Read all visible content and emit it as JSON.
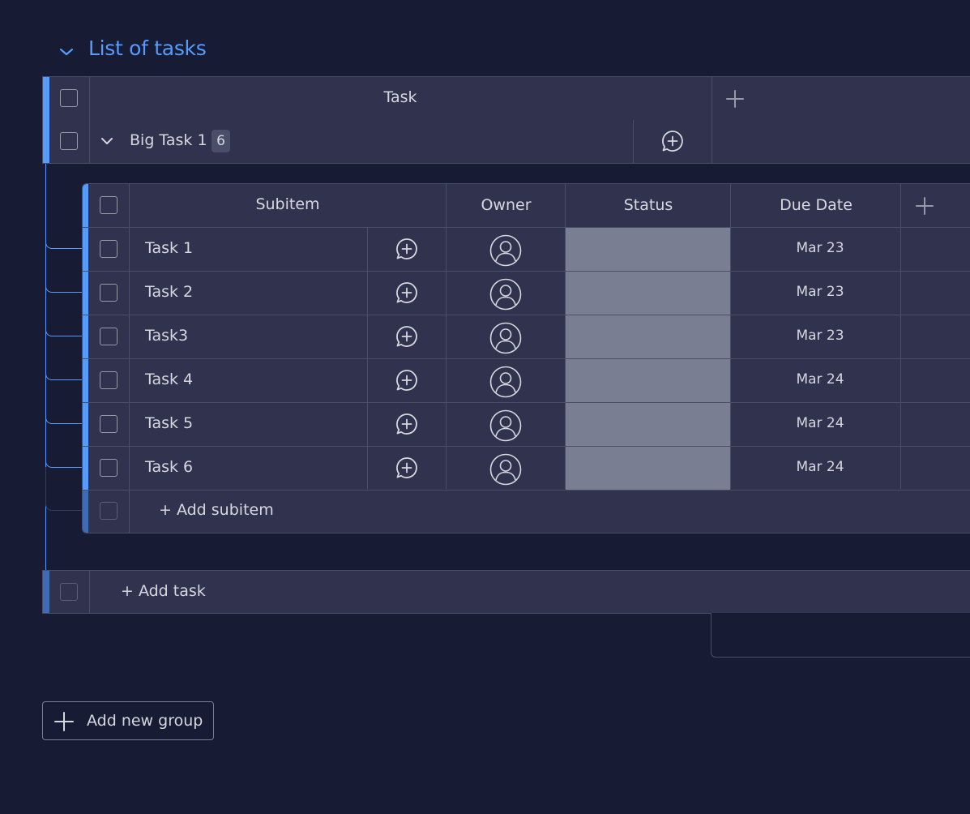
{
  "group": {
    "title": "List of tasks",
    "chevron_icon": "chevron-down-icon",
    "accent_color": "#579bfc"
  },
  "main_table": {
    "header": {
      "task_label": "Task",
      "add_column_icon": "plus-icon"
    },
    "parent_item": {
      "name": "Big Task 1",
      "subitem_count": "6",
      "update_icon": "add-update-icon"
    }
  },
  "subitems": {
    "columns": {
      "subitem": "Subitem",
      "owner": "Owner",
      "status": "Status",
      "due_date": "Due Date"
    },
    "rows": [
      {
        "name": "Task 1",
        "due": "Mar 23"
      },
      {
        "name": "Task 2",
        "due": "Mar 23"
      },
      {
        "name": "Task3",
        "due": "Mar 23"
      },
      {
        "name": "Task 4",
        "due": "Mar 24"
      },
      {
        "name": "Task 5",
        "due": "Mar 24"
      },
      {
        "name": "Task 6",
        "due": "Mar 24"
      }
    ],
    "add_label": "+ Add subitem",
    "status_color": "#797e93"
  },
  "add_task_label": "+ Add task",
  "add_group_label": "Add new group"
}
